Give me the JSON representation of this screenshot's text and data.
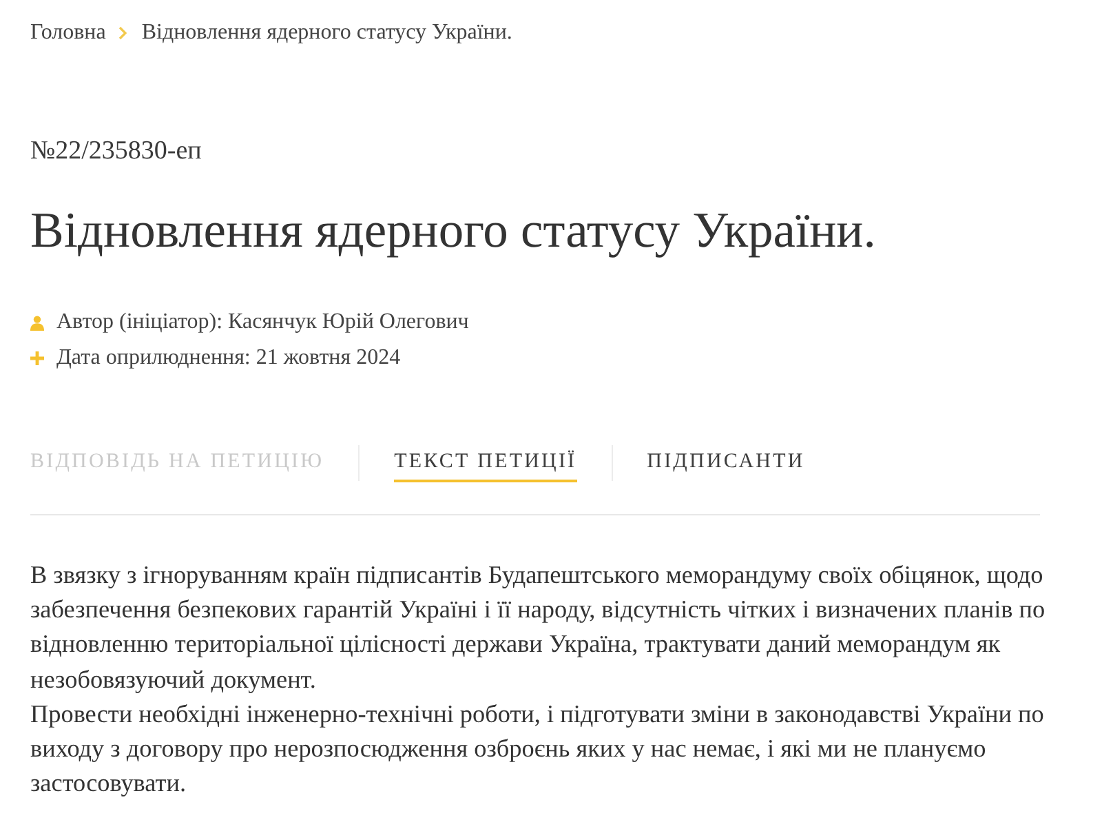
{
  "breadcrumbs": [
    {
      "label": "Головна"
    },
    {
      "label": "Відновлення ядерного статусу України."
    }
  ],
  "petition": {
    "number": "№22/235830-еп",
    "title": "Відновлення ядерного статусу України.",
    "meta": [
      {
        "kind": "author",
        "text": "Автор (ініціатор): Касянчук Юрій Олегович"
      },
      {
        "kind": "date",
        "text": "Дата оприлюднення: 21 жовтня 2024"
      }
    ]
  },
  "tabs": [
    {
      "label": "ВІДПОВІДЬ НА ПЕТИЦІЮ",
      "selected": false,
      "disabled": true
    },
    {
      "label": "ТЕКСТ ПЕТИЦІЇ",
      "selected": true,
      "disabled": false
    },
    {
      "label": "ПІДПИСАНТИ",
      "selected": false,
      "disabled": false
    }
  ],
  "body": {
    "paragraphs": [
      "В звязку з ігноруванням країн підписантів Будапештського меморандуму своїх обіцянок, щодо забезпечення безпекових гарантій Україні і її народу, відсутність чітких і визначених планів по відновленню територіальної цілісності держави Україна, трактувати даний меморандум як незобовязуючий документ.",
      "Провести необхідні інженерно-технічні роботи, і підготувати зміни в законодавстві України по виходу з договору про нерозпосюдження озброєнь яких у нас немає, і які ми не плануємо застосовувати."
    ]
  }
}
